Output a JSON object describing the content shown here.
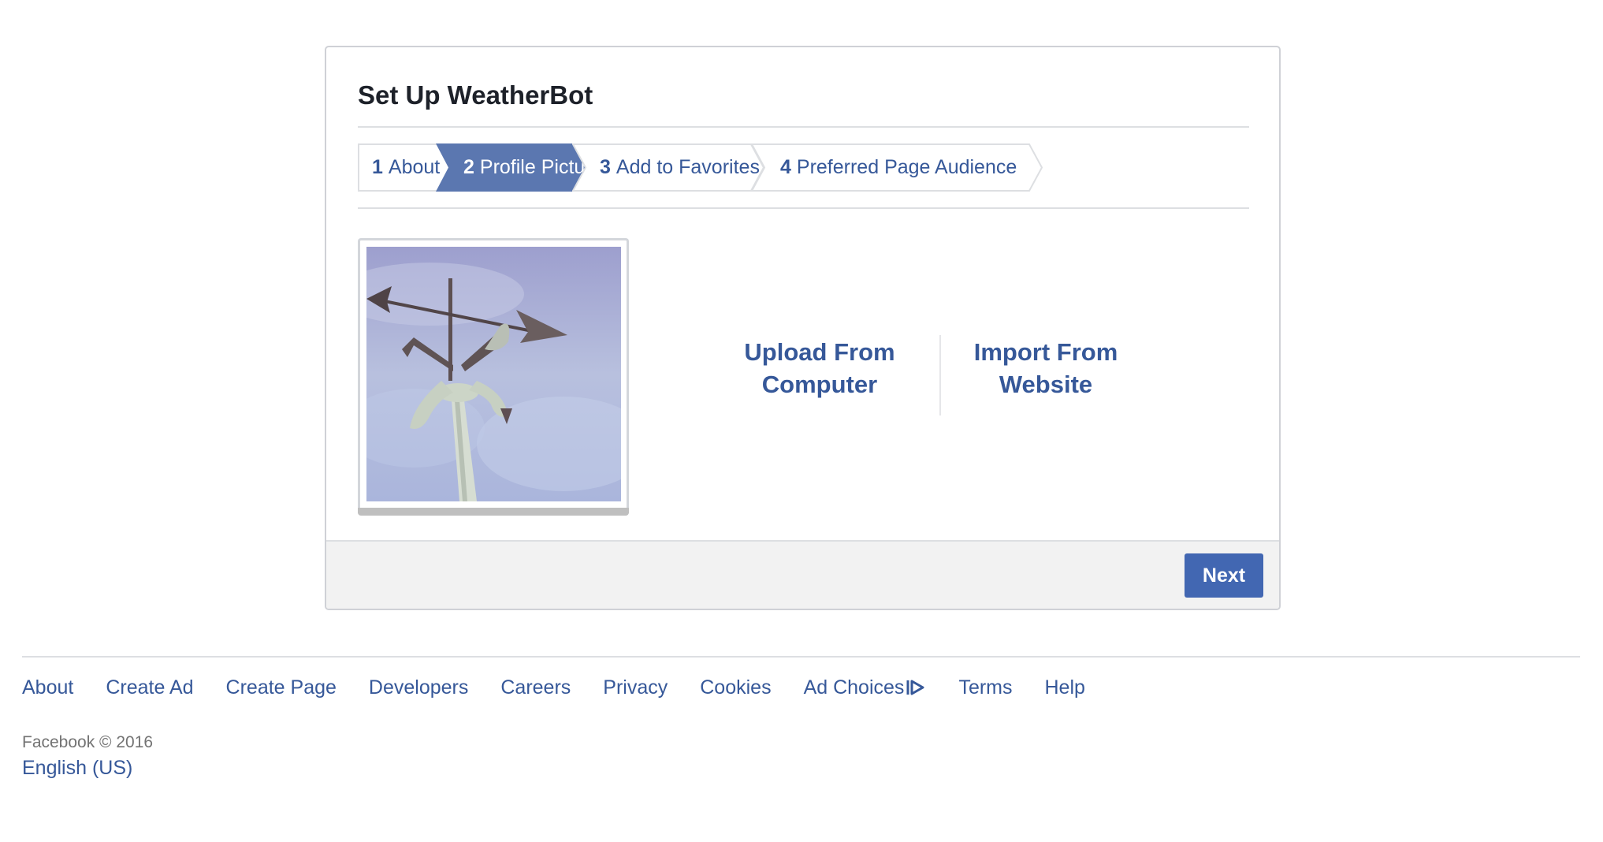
{
  "dialog": {
    "title": "Set Up WeatherBot",
    "steps": [
      {
        "number": "1",
        "label": "About",
        "active": false
      },
      {
        "number": "2",
        "label": "Profile Picture",
        "active": true
      },
      {
        "number": "3",
        "label": "Add to Favorites",
        "active": false
      },
      {
        "number": "4",
        "label": "Preferred Page Audience",
        "active": false
      }
    ],
    "options": {
      "upload_line1": "Upload From",
      "upload_line2": "Computer",
      "import_line1": "Import From",
      "import_line2": "Website"
    },
    "next_label": "Next"
  },
  "colors": {
    "link": "#365899",
    "active_step": "#5b77b0",
    "button": "#4267b2"
  },
  "footer": {
    "links": [
      "About",
      "Create Ad",
      "Create Page",
      "Developers",
      "Careers",
      "Privacy",
      "Cookies",
      "Ad Choices",
      "Terms",
      "Help"
    ],
    "adchoices_icon": "adchoices-icon",
    "copyright": "Facebook © 2016",
    "language": "English (US)"
  }
}
